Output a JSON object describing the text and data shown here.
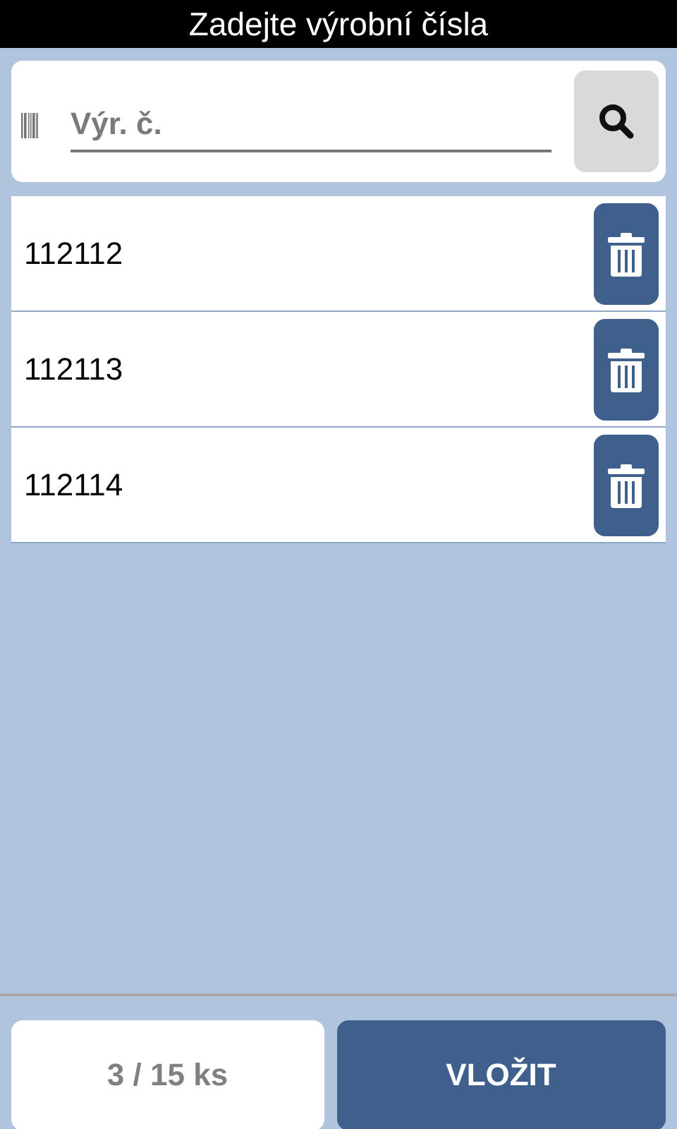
{
  "title": "Zadejte výrobní čísla",
  "search": {
    "placeholder": "Výr. č."
  },
  "serials": [
    {
      "number": "112112"
    },
    {
      "number": "112113"
    },
    {
      "number": "112114"
    }
  ],
  "footer": {
    "count": "3 / 15 ks",
    "submit": "VLOŽIT"
  }
}
